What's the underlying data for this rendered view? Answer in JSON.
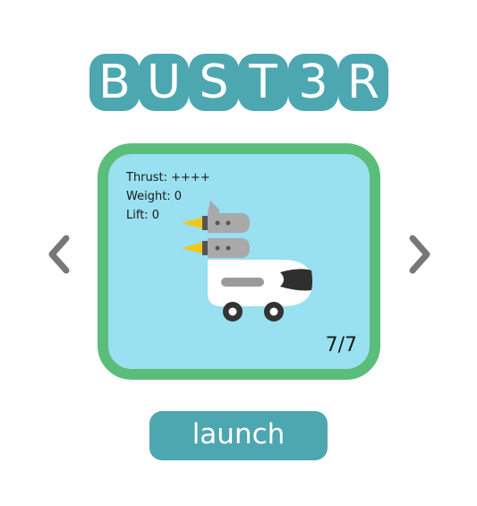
{
  "title": {
    "letters": [
      "B",
      "U",
      "S",
      "T",
      "3",
      "R"
    ]
  },
  "card": {
    "stats": {
      "thrust": "Thrust: ++++",
      "weight": "Weight: 0",
      "lift": "Lift: 0"
    },
    "counter": "7/7"
  },
  "nav": {
    "prev_icon": "chevron-left-icon",
    "next_icon": "chevron-right-icon"
  },
  "launch_button": {
    "label": "launch"
  },
  "colors": {
    "accent_teal": "#4da7b0",
    "card_border_green": "#5bbd7a",
    "card_background": "#99e0f0",
    "chevron_gray": "#777777",
    "flame_yellow": "#f5c518",
    "rocket_gray": "#a9a9a9"
  }
}
